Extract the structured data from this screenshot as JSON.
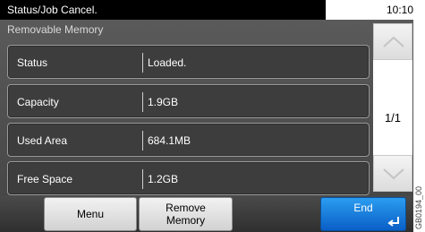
{
  "titlebar": {
    "title": "Status/Job Cancel.",
    "time": "10:10"
  },
  "panel": {
    "header": "Removable Memory",
    "rows": [
      {
        "label": "Status",
        "value": "Loaded."
      },
      {
        "label": "Capacity",
        "value": "1.9GB"
      },
      {
        "label": "Used Area",
        "value": "684.1MB"
      },
      {
        "label": "Free Space",
        "value": "1.2GB"
      }
    ],
    "page_indicator": "1/1"
  },
  "icons": {
    "scroll_up": "chevron-up-icon",
    "scroll_down": "chevron-down-icon",
    "enter": "enter-icon"
  },
  "bottombar": {
    "menu_label": "Menu",
    "remove_line1": "Remove",
    "remove_line2": "Memory",
    "end_label": "End"
  },
  "side_code": "GB0194_00",
  "colors": {
    "panel_bg": "#4f4f4f",
    "end_button": "#1a7fe0",
    "title_bg": "#000000"
  }
}
